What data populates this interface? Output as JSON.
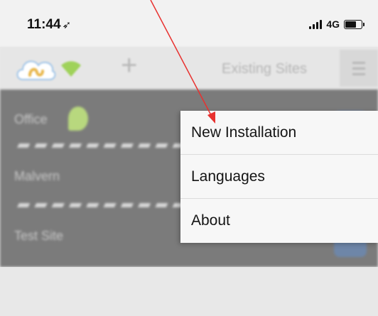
{
  "status_bar": {
    "time": "11:44",
    "location_icon": "location-arrow-icon",
    "network": "4G",
    "signal_icon": "cellular-signal-icon",
    "battery_icon": "battery-icon"
  },
  "toolbar": {
    "logo_icon": "swan-cloud-logo",
    "wifi_icon": "wifi-icon",
    "add_label": "+",
    "existing_sites_label": "Existing Sites",
    "menu_icon": "hamburger-menu-icon"
  },
  "sites": [
    {
      "name": "Office"
    },
    {
      "name": "Malvern"
    },
    {
      "name": "Test Site"
    }
  ],
  "menu": {
    "items": [
      {
        "label": "New Installation"
      },
      {
        "label": "Languages"
      },
      {
        "label": "About"
      }
    ]
  },
  "colors": {
    "annotation_arrow": "#e8312f",
    "overlay": "#7b7b7b",
    "menu_bg": "#f7f7f7"
  }
}
